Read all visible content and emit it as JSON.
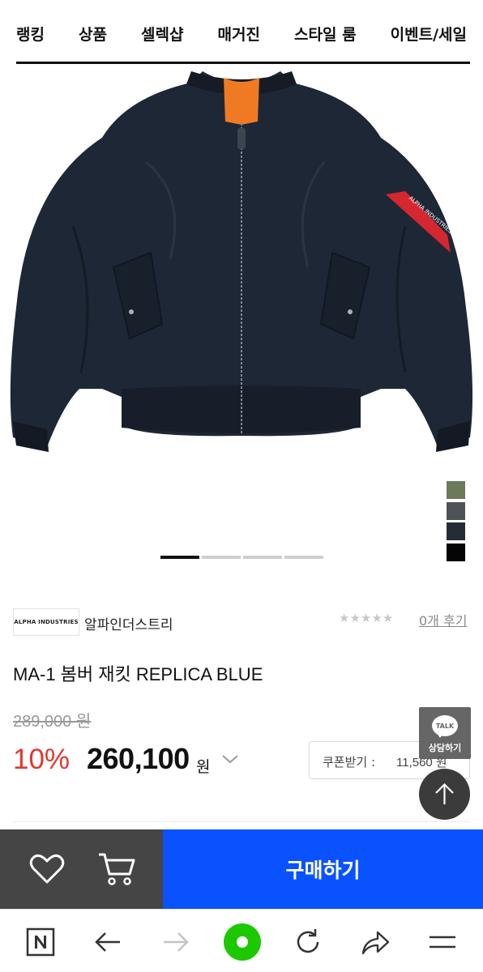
{
  "nav": {
    "items": [
      "랭킹",
      "상품",
      "셀렉샵",
      "매거진",
      "스타일 룸",
      "이벤트/세일"
    ]
  },
  "product": {
    "image_alt": "MA-1 bomber jacket",
    "sleeve_badge": "ALPHA INDUSTRIES",
    "color_swatches": [
      "#6b7a5a",
      "#4e5455",
      "#262c36",
      "#050505"
    ],
    "pager": {
      "total": 4,
      "active": 1
    },
    "brand_logo_text": "ALPHA INDUSTRIES",
    "brand_name": "알파인더스트리",
    "rating_stars": "★★★★★",
    "rating": 0,
    "reviews_label": "0개 후기",
    "title": "MA-1 봄버 재킷 REPLICA BLUE",
    "original_price": "289,000 원",
    "discount": "10%",
    "price": "260,100",
    "price_unit": "원"
  },
  "coupon": {
    "label": "쿠폰받기 :",
    "value": "11,560 원"
  },
  "talk": {
    "bubble": "TALK",
    "label": "상담하기"
  },
  "buy": {
    "label": "구매하기"
  },
  "colors": {
    "accent_blue": "#0b52ff",
    "discount_red": "#e0392c",
    "dark_bar": "#454545",
    "browser_green": "#1ec800"
  }
}
